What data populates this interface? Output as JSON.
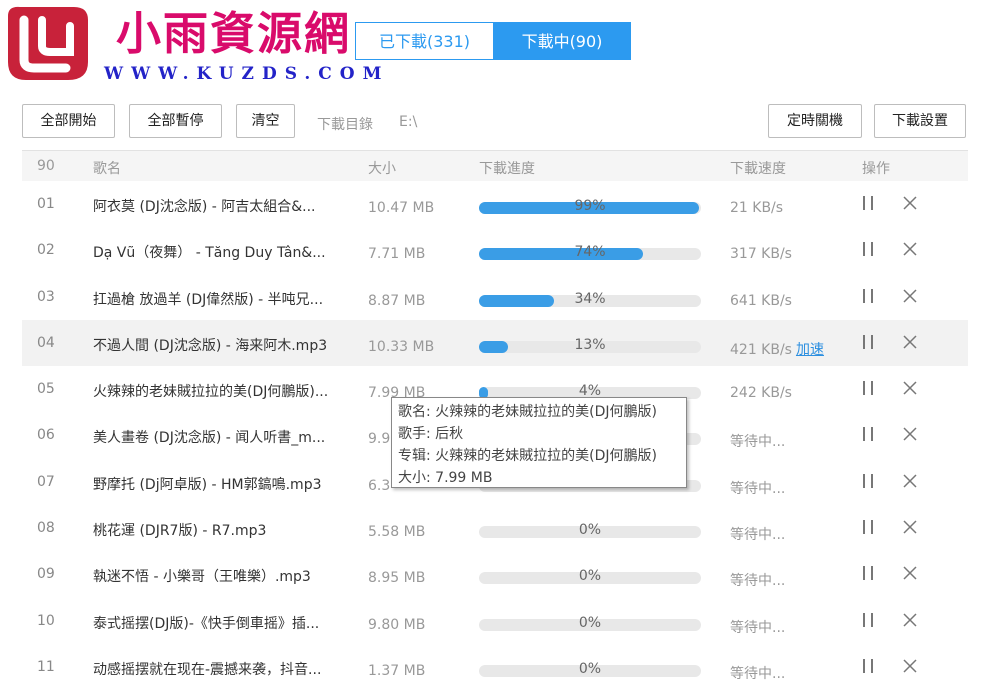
{
  "logo": {
    "title": "小雨資源網",
    "url": "WWW.KUZDS.COM"
  },
  "tabs": {
    "downloaded": "已下載(331)",
    "downloading": "下載中(90)"
  },
  "toolbar": {
    "start_all": "全部開始",
    "pause_all": "全部暫停",
    "clear": "清空",
    "dir_label": "下載目錄",
    "dir_value": "E:\\",
    "shutdown": "定時關機",
    "settings": "下載設置"
  },
  "table": {
    "headers": {
      "count": "90",
      "name": "歌名",
      "size": "大小",
      "progress": "下載進度",
      "speed": "下載速度",
      "ops": "操作"
    },
    "rows": [
      {
        "idx": "01",
        "name": "阿衣莫 (DJ沈念版) - 阿吉太組合&...",
        "size": "10.47 MB",
        "progress": 99,
        "progress_label": "99%",
        "speed": "21 KB/s",
        "boost": ""
      },
      {
        "idx": "02",
        "name": "Dạ Vũ（夜舞） - Tăng Duy Tân&...",
        "size": "7.71 MB",
        "progress": 74,
        "progress_label": "74%",
        "speed": "317 KB/s",
        "boost": ""
      },
      {
        "idx": "03",
        "name": "扛過槍 放過羊 (DJ偉然版) - 半吨兄...",
        "size": "8.87 MB",
        "progress": 34,
        "progress_label": "34%",
        "speed": "641 KB/s",
        "boost": ""
      },
      {
        "idx": "04",
        "name": "不過人間 (DJ沈念版) - 海来阿木.mp3",
        "size": "10.33 MB",
        "progress": 13,
        "progress_label": "13%",
        "speed": "421 KB/s",
        "boost": "加速"
      },
      {
        "idx": "05",
        "name": "火辣辣的老妹賊拉拉的美(DJ何鵬版)...",
        "size": "7.99 MB",
        "progress": 4,
        "progress_label": "4%",
        "speed": "242 KB/s",
        "boost": ""
      },
      {
        "idx": "06",
        "name": "美人畫卷 (DJ沈念版) - 闻人听書_m...",
        "size": "9.9",
        "progress": 0,
        "progress_label": "",
        "speed": "等待中...",
        "boost": ""
      },
      {
        "idx": "07",
        "name": "野摩托 (Dj阿卓版) - HM郭鎬鳴.mp3",
        "size": "6.3",
        "progress": 0,
        "progress_label": "",
        "speed": "等待中...",
        "boost": ""
      },
      {
        "idx": "08",
        "name": "桃花運 (DJR7版) - R7.mp3",
        "size": "5.58 MB",
        "progress": 0,
        "progress_label": "0%",
        "speed": "等待中...",
        "boost": ""
      },
      {
        "idx": "09",
        "name": "執迷不悟 - 小樂哥（王唯樂）.mp3",
        "size": "8.95 MB",
        "progress": 0,
        "progress_label": "0%",
        "speed": "等待中...",
        "boost": ""
      },
      {
        "idx": "10",
        "name": "泰式摇摆(DJ版)-《快手倒車摇》插...",
        "size": "9.80 MB",
        "progress": 0,
        "progress_label": "0%",
        "speed": "等待中...",
        "boost": ""
      },
      {
        "idx": "11",
        "name": "动感摇摆就在现在-震撼来袭，抖音...",
        "size": "1.37 MB",
        "progress": 0,
        "progress_label": "0%",
        "speed": "等待中...",
        "boost": ""
      }
    ]
  },
  "tooltip": {
    "song": "歌名:  火辣辣的老妹賊拉拉的美(DJ何鵬版)",
    "artist": "歌手:  后秋",
    "album": "专辑:  火辣辣的老妹賊拉拉的美(DJ何鵬版)",
    "size": "大小:  7.99 MB"
  },
  "colors": {
    "accent": "#2c9af0",
    "logo_red": "#d90b6b",
    "logo_blue": "#2323c8",
    "logo_mark": "#c8223a"
  },
  "icons": {
    "logo": "u-cup-logo-icon",
    "pause": "pause-icon",
    "close": "close-icon"
  }
}
